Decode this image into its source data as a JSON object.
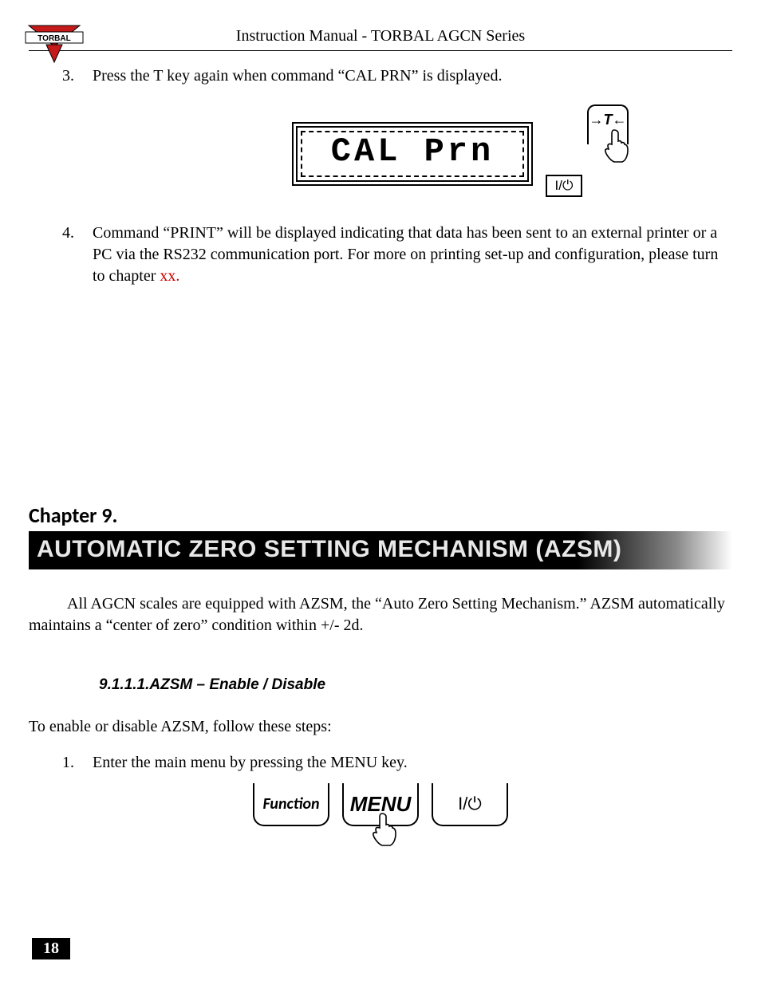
{
  "header": {
    "title": "Instruction Manual - TORBAL AGCN Series",
    "logo_text": "TORBAL"
  },
  "steps_a": [
    "Press the T key again when command “CAL PRN” is displayed.",
    "Command “PRINT” will be displayed indicating that data has been sent to an external printer or a PC via the RS232 communication port.  For more on printing set-up and configuration, please turn to chapter "
  ],
  "steps_a_start": 3,
  "xx_text": "xx.",
  "lcd": {
    "display_text": "CAL Prn",
    "io_label": "I/⏻",
    "t_label": "→T←"
  },
  "chapter": {
    "label": "Chapter 9.",
    "title": "AUTOMATIC ZERO SETTING MECHANISM (AZSM)"
  },
  "intro_para": "All AGCN scales are equipped with AZSM, the “Auto Zero Setting Mechanism.”  AZSM automatically maintains a “center of zero” condition within +/- 2d.",
  "sub_heading": "9.1.1.1.AZSM – Enable / Disable",
  "enable_intro": "To enable or disable AZSM, follow these steps:",
  "steps_b": [
    "Enter the main menu by pressing the MENU key."
  ],
  "keys": {
    "function": "Function",
    "menu": "MENU",
    "power": "I/⏻"
  },
  "page_number": "18"
}
